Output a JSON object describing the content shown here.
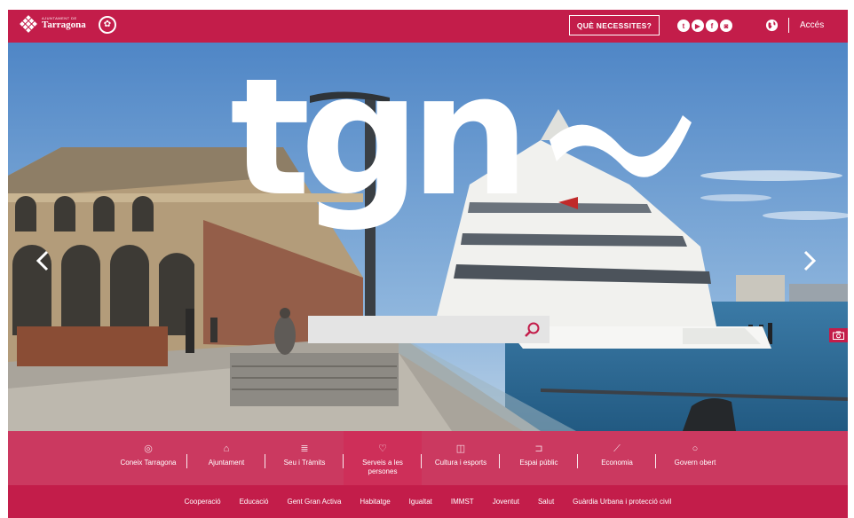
{
  "topbar": {
    "logo_small": "AJUNTAMENT DE",
    "logo_name": "Tarragona",
    "need_button": "QUÈ NECESSITES?",
    "social_icons": [
      "twitter-icon",
      "youtube-icon",
      "facebook-icon",
      "instagram-icon"
    ],
    "login": "Accés"
  },
  "hero": {
    "logo_text": "tgn",
    "search_placeholder": ""
  },
  "nav": {
    "items": [
      {
        "label": "Coneix Tarragona",
        "icon": "eye-icon",
        "glyph": "◎"
      },
      {
        "label": "Ajuntament",
        "icon": "building-icon",
        "glyph": "⌂"
      },
      {
        "label": "Seu i Tràmits",
        "icon": "list-icon",
        "glyph": "≣"
      },
      {
        "label": "Serveis a les persones",
        "icon": "heart-icon",
        "glyph": "♡"
      },
      {
        "label": "Cultura i esports",
        "icon": "book-icon",
        "glyph": "◫"
      },
      {
        "label": "Espai públic",
        "icon": "street-icon",
        "glyph": "⊐"
      },
      {
        "label": "Economia",
        "icon": "trend-icon",
        "glyph": "⟋"
      },
      {
        "label": "Govern obert",
        "icon": "circle-icon",
        "glyph": "○"
      }
    ],
    "active_index": 3
  },
  "sublinks": [
    "Cooperació",
    "Educació",
    "Gent Gran Activa",
    "Habitatge",
    "Igualtat",
    "IMMST",
    "Joventut",
    "Salut",
    "Guàrdia Urbana i protecció civil"
  ],
  "colors": {
    "brand": "#c31d4a",
    "sky": "#5d8fc6",
    "sea": "#2f6e98"
  }
}
